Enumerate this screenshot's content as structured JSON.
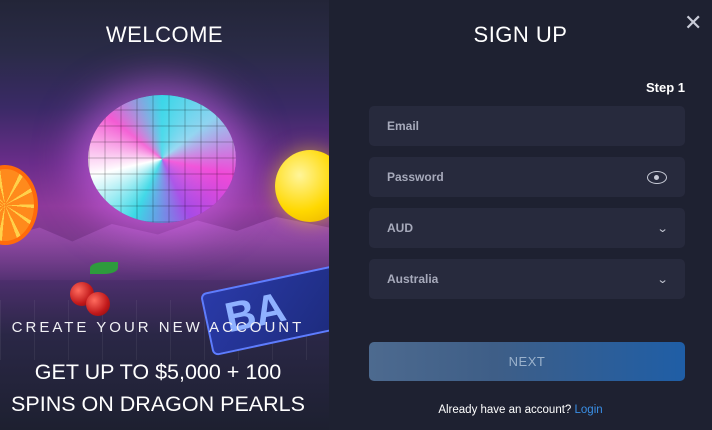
{
  "promo_panel": {
    "title": "WELCOME",
    "subtitle": "CREATE YOUR NEW ACCOUNT",
    "promo_line1": "GET UP TO $5,000 + 100",
    "promo_line2": "SPINS ON DRAGON PEARLS",
    "tile_text": "BA"
  },
  "signup": {
    "title": "SIGN UP",
    "step": "Step 1",
    "close_icon": "close-icon",
    "fields": {
      "email": {
        "placeholder": "Email"
      },
      "password": {
        "placeholder": "Password",
        "icon": "eye-icon"
      },
      "currency": {
        "selected": "AUD",
        "icon": "chevron-down-icon"
      },
      "country": {
        "selected": "Australia",
        "icon": "chevron-down-icon"
      }
    },
    "next_label": "NEXT",
    "login_prompt": "Already have an account?",
    "login_link": "Login"
  },
  "colors": {
    "panel_bg": "#1e2131",
    "field_bg": "#272a3d",
    "link": "#3a8fe6",
    "button_start": "#4d6a8f",
    "button_end": "#1f5ea6"
  }
}
